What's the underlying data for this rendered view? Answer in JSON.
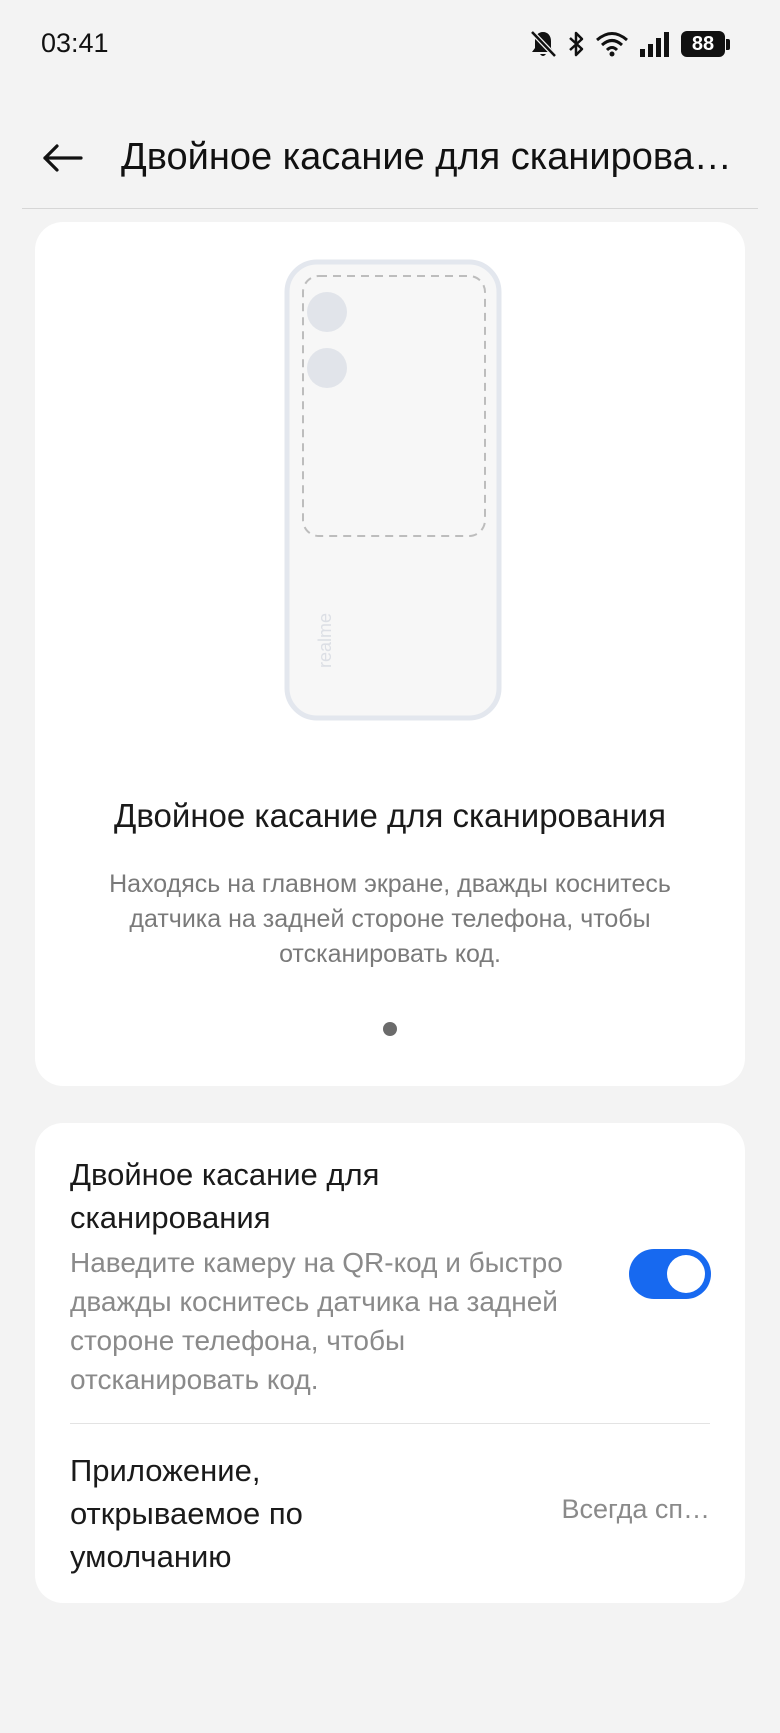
{
  "status_bar": {
    "time": "03:41",
    "battery_level": "88",
    "icons": [
      "bell-muted-icon",
      "bluetooth-icon",
      "wifi-icon",
      "signal-icon",
      "battery-icon"
    ]
  },
  "header": {
    "title": "Двойное касание для сканирова…",
    "back_icon": "arrow-left-icon"
  },
  "intro": {
    "illustration": "phone-back-illustration",
    "brand_text": "realme",
    "title": "Двойное касание для сканирования",
    "description": "Находясь на главном экране, дважды коснитесь датчика на задней стороне телефона, чтобы отсканировать код.",
    "page_indicator": {
      "current": 1,
      "total": 1
    }
  },
  "settings": {
    "double_tap": {
      "title": "Двойное касание для сканирования",
      "description": "Наведите камеру на QR-код и быстро дважды коснитесь датчика на задней стороне телефона, чтобы отсканировать код.",
      "enabled": true
    },
    "default_app": {
      "title": "Приложение, открываемое по умолчанию",
      "value": "Всегда сп…"
    }
  },
  "colors": {
    "background": "#f3f3f3",
    "card": "#ffffff",
    "accent": "#1769f0",
    "secondary_text": "#8a8a8a"
  }
}
